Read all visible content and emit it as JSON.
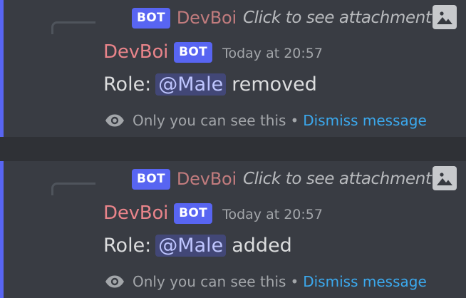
{
  "messages": [
    {
      "reply": {
        "badge": "BOT",
        "author": "DevBoi",
        "text": "Click to see attachment",
        "attachment_icon": "image-icon"
      },
      "author": "DevBoi",
      "badge": "BOT",
      "timestamp": "Today at 20:57",
      "content": {
        "prefix": "Role:",
        "mention": "@Male",
        "suffix": "removed"
      },
      "ephemeral": {
        "icon": "eye-icon",
        "text": "Only you can see this",
        "separator": "•",
        "dismiss_label": "Dismiss message"
      }
    },
    {
      "reply": {
        "badge": "BOT",
        "author": "DevBoi",
        "text": "Click to see attachment",
        "attachment_icon": "image-icon"
      },
      "author": "DevBoi",
      "badge": "BOT",
      "timestamp": "Today at 20:57",
      "content": {
        "prefix": "Role:",
        "mention": "@Male",
        "suffix": "added"
      },
      "ephemeral": {
        "icon": "eye-icon",
        "text": "Only you can see this",
        "separator": "•",
        "dismiss_label": "Dismiss message"
      }
    }
  ],
  "colors": {
    "background": "#36393f",
    "message_highlight": "#393c43",
    "accent_bar": "#5865f2",
    "bot_badge": "#5865f2",
    "username": "#e9848a",
    "mention_bg": "#414675",
    "mention_text": "#c9cdfb",
    "dismiss_link": "#3ba9ee"
  }
}
